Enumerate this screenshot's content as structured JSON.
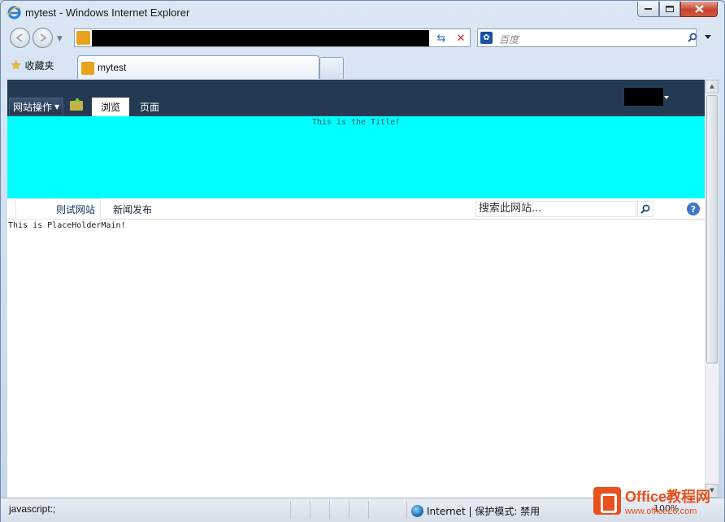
{
  "window": {
    "title": "mytest - Windows Internet Explorer",
    "icon": "ie-logo-icon"
  },
  "navbar": {
    "back_icon": "back-arrow-icon",
    "forward_icon": "forward-arrow-icon",
    "address_value": "",
    "search_placeholder": "百度",
    "refresh_glyph": "⇆",
    "stop_glyph": "✕",
    "search_glyph": "⚲"
  },
  "tabs": {
    "favorites_label": "收藏夹",
    "active_tab_label": "mytest"
  },
  "ribbon": {
    "site_actions_label": "网站操作",
    "tab_browse": "浏览",
    "tab_page": "页面"
  },
  "page": {
    "title": "This is the Title!",
    "nav_items": [
      "则试网站",
      "新闻发布"
    ],
    "search_placeholder": "搜索此网站...",
    "help_glyph": "?",
    "main_text": "This is PlaceHolderMain!",
    "colors": {
      "ribbon": "#243a53",
      "title_band": "#00ffff"
    }
  },
  "status": {
    "left_text": "javascript:;",
    "zone_text": "Internet | 保护模式: 禁用",
    "zoom": "100%"
  },
  "watermark": {
    "main": "Office教程网",
    "sub": "www.office26.com"
  }
}
